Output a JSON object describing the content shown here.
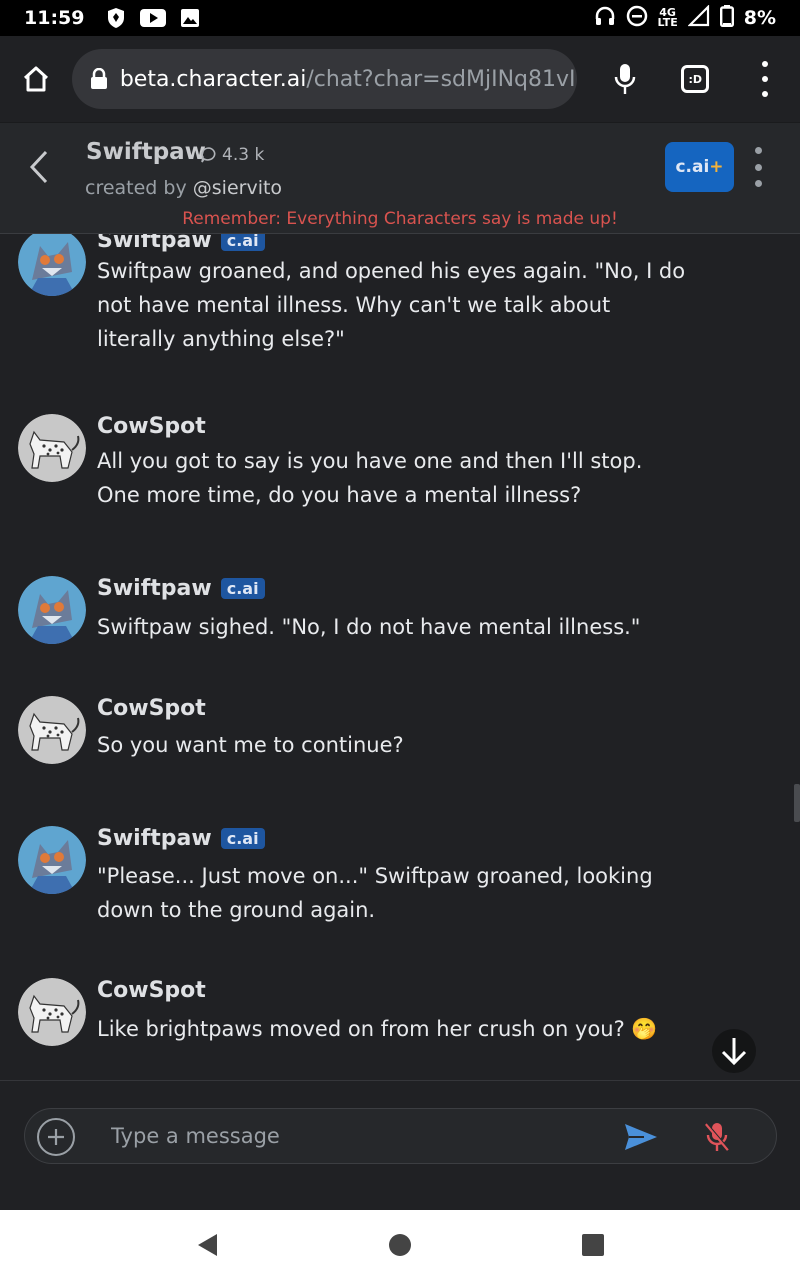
{
  "status_bar": {
    "time": "11:59",
    "network": "4G",
    "network_sub": "LTE",
    "battery": "8%"
  },
  "browser": {
    "url_host": "beta.character.ai",
    "url_path": "/chat?char=sdMjINq81vI"
  },
  "header": {
    "character_name": "Swiftpaw",
    "chat_count": "4.3 k",
    "created_by_label": "created by",
    "creator_handle": "@siervito",
    "plus_label": "c.ai",
    "plus_sign": "+",
    "disclaimer": "Remember: Everything Characters say is made up!"
  },
  "messages": [
    {
      "sender": "Swiftpaw",
      "badge": "c.ai",
      "avatar": "blue-cat-avatar",
      "text": "Swiftpaw groaned, and opened his eyes again. \"No, I do not have mental illness. Why can't we talk about literally anything else?\""
    },
    {
      "sender": "CowSpot",
      "badge": "",
      "avatar": "spotted-cat-avatar",
      "text": "All you got to say is you have one and then I'll stop. One more time, do you have a mental illness?"
    },
    {
      "sender": "Swiftpaw",
      "badge": "c.ai",
      "avatar": "blue-cat-avatar",
      "text": "Swiftpaw sighed. \"No, I do not have mental illness.\""
    },
    {
      "sender": "CowSpot",
      "badge": "",
      "avatar": "spotted-cat-avatar",
      "text": "So you want me to continue?"
    },
    {
      "sender": "Swiftpaw",
      "badge": "c.ai",
      "avatar": "blue-cat-avatar",
      "text": "\"Please... Just move on...\" Swiftpaw groaned, looking down to the ground again."
    },
    {
      "sender": "CowSpot",
      "badge": "",
      "avatar": "spotted-cat-avatar",
      "text": "Like brightpaws moved on from her crush on you? 🤭"
    }
  ],
  "composer": {
    "placeholder": "Type a message"
  },
  "colors": {
    "accent": "#1565c0",
    "send": "#4a90d9",
    "mic_muted": "#e0545a",
    "disclaimer": "#d9534f"
  }
}
